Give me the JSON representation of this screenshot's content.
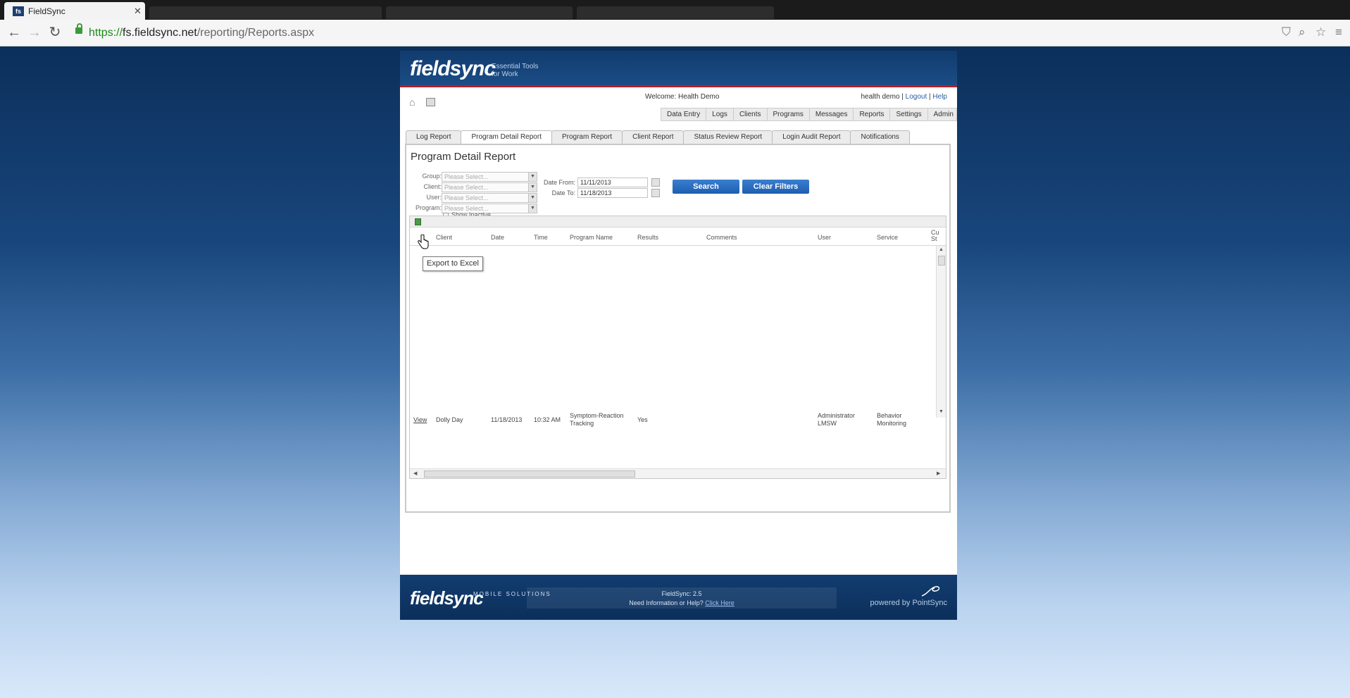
{
  "browser": {
    "tab_title": "FieldSync",
    "tab_favicon": "fs",
    "url_secure": "https://",
    "url_domain": "fs.fieldsync.net",
    "url_path": "/reporting/Reports.aspx"
  },
  "app": {
    "logo": "fieldsync",
    "tagline": "Essential Tools for Work",
    "welcome": "Welcome: Health Demo",
    "user_name": "health demo",
    "logout_label": "Logout",
    "help_label": "Help",
    "menu": [
      "Data Entry",
      "Logs",
      "Clients",
      "Programs",
      "Messages",
      "Reports",
      "Settings",
      "Admin"
    ]
  },
  "report_tabs": [
    "Log Report",
    "Program Detail Report",
    "Program Report",
    "Client Report",
    "Status Review Report",
    "Login Audit Report",
    "Notifications"
  ],
  "report": {
    "title": "Program Detail Report",
    "filters": {
      "group_label": "Group:",
      "client_label": "Client:",
      "user_label": "User:",
      "program_label": "Program:",
      "placeholder": "Please Select...",
      "show_inactive_label": "Show Inactive"
    },
    "dates": {
      "from_label": "Date From:",
      "from_value": "11/11/2013",
      "to_label": "Date To:",
      "to_value": "11/18/2013"
    },
    "search_label": "Search",
    "clear_label": "Clear Filters",
    "grid": {
      "columns": [
        "Client",
        "Date",
        "Time",
        "Program Name",
        "Results",
        "Comments",
        "User",
        "Service",
        "Cu St"
      ],
      "row": {
        "view": "View",
        "client": "Dolly Day",
        "date": "11/18/2013",
        "time": "10:32 AM",
        "program": "Symptom-Reaction Tracking",
        "result": "Yes",
        "user": "Administrator LMSW",
        "service": "Behavior Monitoring"
      }
    },
    "tooltip": "Export to Excel"
  },
  "footer": {
    "logo": "fieldsync",
    "sub": "MOBILE SOLUTIONS",
    "version": "FieldSync: 2.5",
    "help_text": "Need Information or Help?",
    "help_link": "Click Here",
    "powered": "powered by PointSync"
  },
  "colors": {
    "header_blue": "#103b6e",
    "accent_red": "#b3202a",
    "button_blue": "#1e5eaf"
  }
}
